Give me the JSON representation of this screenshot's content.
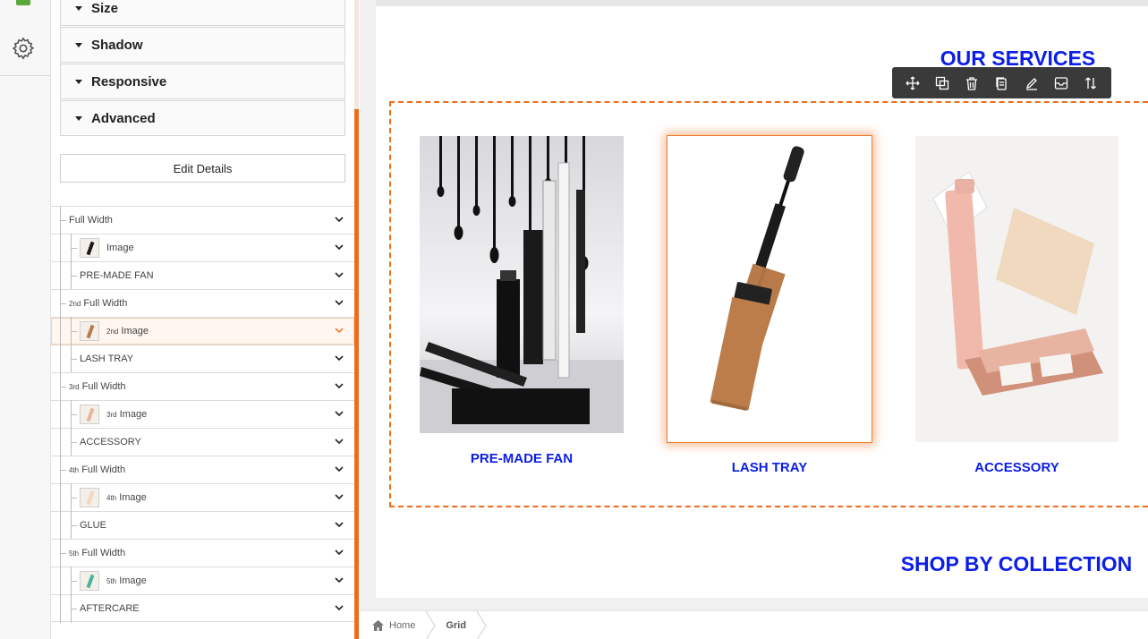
{
  "panel": {
    "sections": [
      {
        "label": "Size"
      },
      {
        "label": "Shadow"
      },
      {
        "label": "Responsive"
      },
      {
        "label": "Advanced"
      }
    ],
    "edit_details_label": "Edit Details"
  },
  "tree": [
    {
      "label": "Full Width",
      "level": 1
    },
    {
      "label": "Image",
      "level": 2,
      "thumb": true
    },
    {
      "label": "PRE-MADE FAN",
      "level": 2
    },
    {
      "prefix": "2nd",
      "label": "Full Width",
      "level": 1
    },
    {
      "prefix": "2nd",
      "label": "Image",
      "level": 2,
      "thumb": true,
      "selected": true
    },
    {
      "label": "LASH TRAY",
      "level": 2
    },
    {
      "prefix": "3rd",
      "label": "Full Width",
      "level": 1
    },
    {
      "prefix": "3rd",
      "label": "Image",
      "level": 2,
      "thumb": true
    },
    {
      "label": "ACCESSORY",
      "level": 2
    },
    {
      "prefix": "4th",
      "label": "Full Width",
      "level": 1
    },
    {
      "prefix": "4th",
      "label": "Image",
      "level": 2,
      "thumb": true
    },
    {
      "label": "GLUE",
      "level": 2
    },
    {
      "prefix": "5th",
      "label": "Full Width",
      "level": 1
    },
    {
      "prefix": "5th",
      "label": "Image",
      "level": 2,
      "thumb": true
    },
    {
      "label": "AFTERCARE",
      "level": 2
    }
  ],
  "canvas": {
    "services_title": "OUR SERVICES",
    "collection_title": "SHOP BY COLLECTION",
    "cards": [
      {
        "caption": "PRE-MADE FAN",
        "image_text": "EYELINER"
      },
      {
        "caption": "LASH TRAY",
        "image_text": "Bamboo Mascara"
      },
      {
        "caption": "ACCESSORY",
        "image_text": "Makeup and Cards Scenes"
      }
    ],
    "toolbar": [
      "move-icon",
      "resize-icon",
      "trash-icon",
      "duplicate-icon",
      "edit-icon",
      "save-block-icon",
      "reorder-icon"
    ]
  },
  "breadcrumb": {
    "home": "Home",
    "current": "Grid"
  },
  "colors": {
    "accent": "#ef6c1a",
    "title_blue": "#0b1ee6"
  }
}
